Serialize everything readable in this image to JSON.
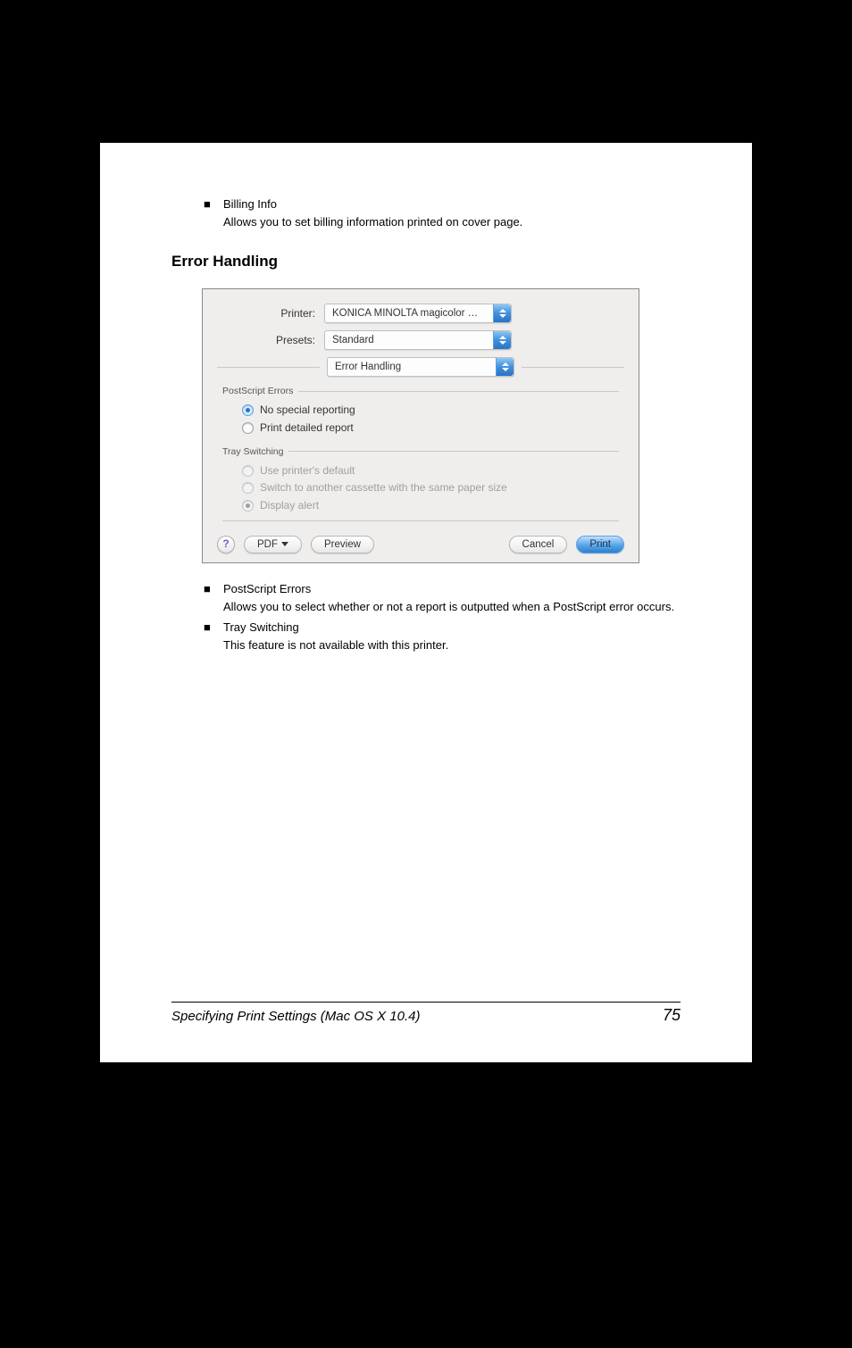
{
  "bullets_top": [
    {
      "title": "Billing Info",
      "desc": "Allows you to set billing information printed on cover page."
    }
  ],
  "section_heading": "Error Handling",
  "dialog": {
    "printer_label": "Printer:",
    "printer_value": "KONICA MINOLTA magicolor …",
    "presets_label": "Presets:",
    "presets_value": "Standard",
    "pane_value": "Error Handling",
    "groups": {
      "ps_errors": {
        "title": "PostScript Errors",
        "options": [
          {
            "label": "No special reporting",
            "selected": true
          },
          {
            "label": "Print detailed report",
            "selected": false
          }
        ]
      },
      "tray": {
        "title": "Tray Switching",
        "options": [
          {
            "label": "Use printer's default"
          },
          {
            "label": "Switch to another cassette with the same paper size"
          },
          {
            "label": "Display alert",
            "selected": true
          }
        ]
      }
    },
    "buttons": {
      "help": "?",
      "pdf": "PDF",
      "preview": "Preview",
      "cancel": "Cancel",
      "print": "Print"
    }
  },
  "bullets_bottom": [
    {
      "title": "PostScript Errors",
      "desc": "Allows you to select whether or not a report is outputted when a Post­Script error occurs."
    },
    {
      "title": "Tray Switching",
      "desc": "This feature is not available with this printer."
    }
  ],
  "footer": {
    "title": "Specifying Print Settings (Mac OS X 10.4)",
    "page": "75"
  }
}
